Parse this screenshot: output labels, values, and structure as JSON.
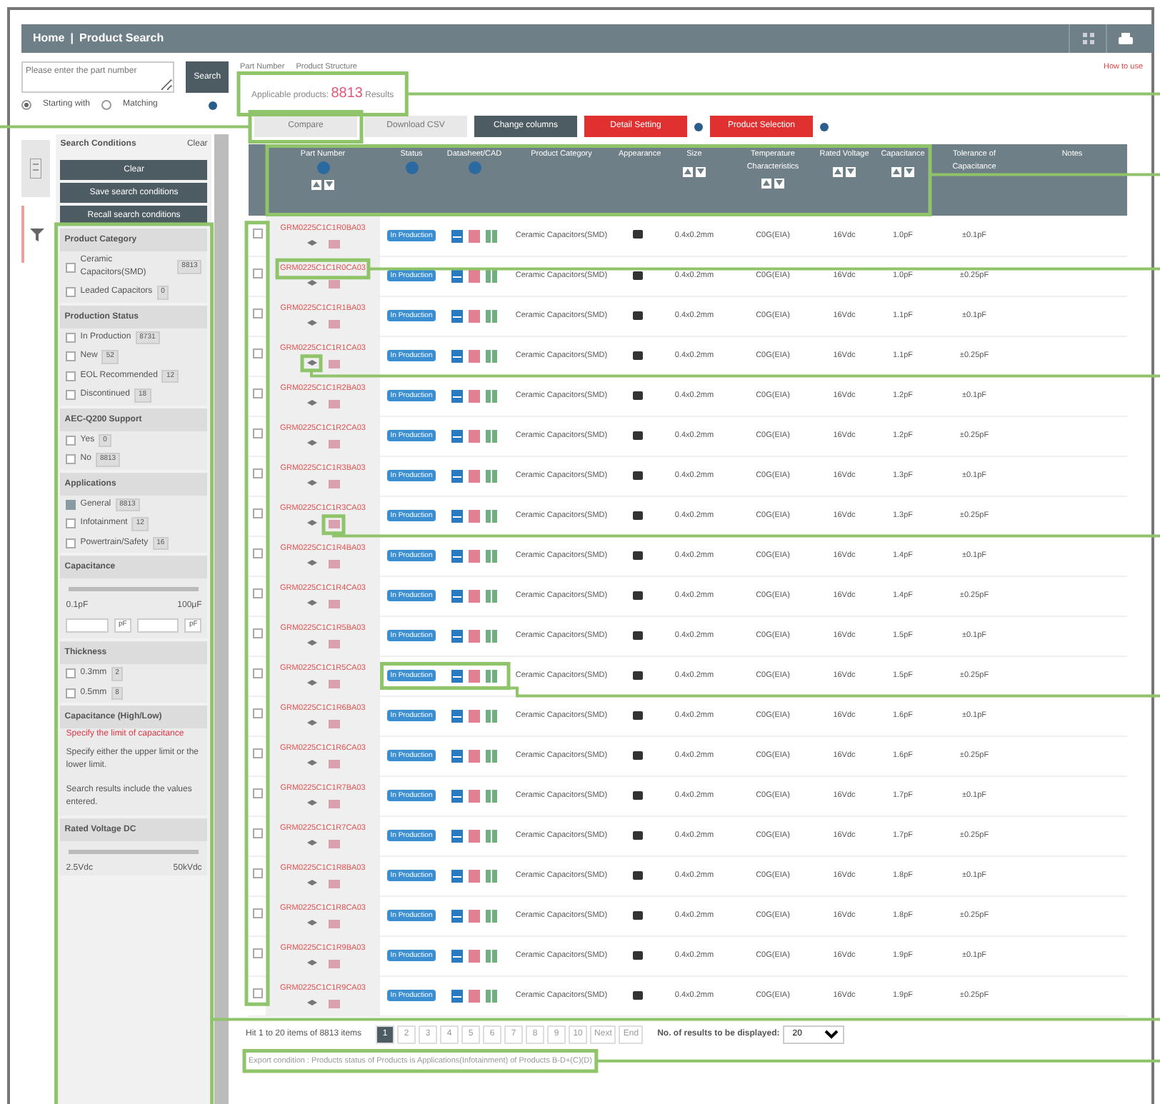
{
  "header": {
    "breadcrumb": [
      "Home",
      "Product Search"
    ],
    "separator": "|"
  },
  "search": {
    "placeholder": "Please enter the part number",
    "button": "Search",
    "modes": [
      {
        "label": "Starting with",
        "selected": true
      },
      {
        "label": "Matching",
        "selected": false
      }
    ]
  },
  "tabs": [
    "Part Number",
    "Product Structure"
  ],
  "help_link": "How to use",
  "result": {
    "label": "Applicable products:",
    "count": "8813",
    "unit": "Results"
  },
  "actions": [
    {
      "label": "Compare",
      "kind": "light"
    },
    {
      "label": "Download CSV",
      "kind": "light"
    },
    {
      "label": "Change columns",
      "kind": "dark"
    },
    {
      "label": "Detail Setting",
      "kind": "red"
    },
    {
      "label": "Product Selection",
      "kind": "red"
    }
  ],
  "sidebar": {
    "title": "Search Conditions",
    "clear": "Clear",
    "buttons": [
      "Clear",
      "Save search conditions",
      "Recall search conditions"
    ],
    "sections": [
      {
        "title": "Product Category",
        "options": [
          {
            "label": "Ceramic Capacitors(SMD)",
            "count": "8813",
            "checked": false
          },
          {
            "label": "Leaded Capacitors",
            "count": "0",
            "checked": false
          }
        ]
      },
      {
        "title": "Production Status",
        "options": [
          {
            "label": "In Production",
            "count": "8731",
            "checked": false
          },
          {
            "label": "New",
            "count": "52",
            "checked": false
          },
          {
            "label": "EOL Recommended",
            "count": "12",
            "checked": false
          },
          {
            "label": "Discontinued",
            "count": "18",
            "checked": false
          }
        ]
      },
      {
        "title": "AEC-Q200 Support",
        "options": [
          {
            "label": "Yes",
            "count": "0",
            "checked": false
          },
          {
            "label": "No",
            "count": "8813",
            "checked": false
          }
        ]
      },
      {
        "title": "Applications",
        "options": [
          {
            "label": "General",
            "count": "8813",
            "checked": true
          },
          {
            "label": "Infotainment",
            "count": "12",
            "checked": false
          },
          {
            "label": "Powertrain/Safety",
            "count": "16",
            "checked": false
          }
        ]
      },
      {
        "title": "Capacitance",
        "range": [
          "0.1pF",
          "100μF"
        ],
        "units": [
          "pF",
          "pF"
        ]
      },
      {
        "title": "Thickness",
        "options": [
          {
            "label": "0.3mm",
            "count": "2",
            "checked": false
          },
          {
            "label": "0.5mm",
            "count": "8",
            "checked": false
          }
        ]
      },
      {
        "title": "Capacitance (High/Low)",
        "link": "Specify the limit of capacitance",
        "notes": [
          "Specify either the upper limit or the lower limit.",
          "Search results include the values entered."
        ]
      },
      {
        "title": "Rated Voltage DC",
        "range": [
          "2.5Vdc",
          "50kVdc"
        ]
      }
    ]
  },
  "table": {
    "columns": [
      "Part Number",
      "Status",
      "Datasheet/CAD",
      "Product Category",
      "Appearance",
      "Size",
      "Temperature Characteristics",
      "Rated Voltage",
      "Capacitance",
      "Tolerance of Capacitance",
      "Notes"
    ],
    "rows": [
      {
        "part": "GRM0225C1C1R0BA03",
        "checked": false,
        "status": "In Production",
        "category": "Ceramic Capacitors(SMD)",
        "size": "0.4x0.2mm",
        "temp": "C0G(EIA)",
        "volt": "16Vdc",
        "cap": "1.0pF",
        "tol": "±0.1pF"
      },
      {
        "part": "GRM0225C1C1R0CA03",
        "checked": false,
        "status": "In Production",
        "category": "Ceramic Capacitors(SMD)",
        "size": "0.4x0.2mm",
        "temp": "C0G(EIA)",
        "volt": "16Vdc",
        "cap": "1.0pF",
        "tol": "±0.25pF"
      },
      {
        "part": "GRM0225C1C1R1BA03",
        "checked": false,
        "status": "In Production",
        "category": "Ceramic Capacitors(SMD)",
        "size": "0.4x0.2mm",
        "temp": "C0G(EIA)",
        "volt": "16Vdc",
        "cap": "1.1pF",
        "tol": "±0.1pF"
      },
      {
        "part": "GRM0225C1C1R1CA03",
        "checked": false,
        "status": "In Production",
        "category": "Ceramic Capacitors(SMD)",
        "size": "0.4x0.2mm",
        "temp": "C0G(EIA)",
        "volt": "16Vdc",
        "cap": "1.1pF",
        "tol": "±0.25pF"
      },
      {
        "part": "GRM0225C1C1R2BA03",
        "checked": false,
        "status": "In Production",
        "category": "Ceramic Capacitors(SMD)",
        "size": "0.4x0.2mm",
        "temp": "C0G(EIA)",
        "volt": "16Vdc",
        "cap": "1.2pF",
        "tol": "±0.1pF"
      },
      {
        "part": "GRM0225C1C1R2CA03",
        "checked": false,
        "status": "In Production",
        "category": "Ceramic Capacitors(SMD)",
        "size": "0.4x0.2mm",
        "temp": "C0G(EIA)",
        "volt": "16Vdc",
        "cap": "1.2pF",
        "tol": "±0.25pF"
      },
      {
        "part": "GRM0225C1C1R3BA03",
        "checked": false,
        "status": "In Production",
        "category": "Ceramic Capacitors(SMD)",
        "size": "0.4x0.2mm",
        "temp": "C0G(EIA)",
        "volt": "16Vdc",
        "cap": "1.3pF",
        "tol": "±0.1pF"
      },
      {
        "part": "GRM0225C1C1R3CA03",
        "checked": false,
        "status": "In Production",
        "category": "Ceramic Capacitors(SMD)",
        "size": "0.4x0.2mm",
        "temp": "C0G(EIA)",
        "volt": "16Vdc",
        "cap": "1.3pF",
        "tol": "±0.25pF"
      },
      {
        "part": "GRM0225C1C1R4BA03",
        "checked": false,
        "status": "In Production",
        "category": "Ceramic Capacitors(SMD)",
        "size": "0.4x0.2mm",
        "temp": "C0G(EIA)",
        "volt": "16Vdc",
        "cap": "1.4pF",
        "tol": "±0.1pF"
      },
      {
        "part": "GRM0225C1C1R4CA03",
        "checked": false,
        "status": "In Production",
        "category": "Ceramic Capacitors(SMD)",
        "size": "0.4x0.2mm",
        "temp": "C0G(EIA)",
        "volt": "16Vdc",
        "cap": "1.4pF",
        "tol": "±0.25pF"
      },
      {
        "part": "GRM0225C1C1R5BA03",
        "checked": false,
        "status": "In Production",
        "category": "Ceramic Capacitors(SMD)",
        "size": "0.4x0.2mm",
        "temp": "C0G(EIA)",
        "volt": "16Vdc",
        "cap": "1.5pF",
        "tol": "±0.1pF"
      },
      {
        "part": "GRM0225C1C1R5CA03",
        "checked": false,
        "status": "In Production",
        "category": "Ceramic Capacitors(SMD)",
        "size": "0.4x0.2mm",
        "temp": "C0G(EIA)",
        "volt": "16Vdc",
        "cap": "1.5pF",
        "tol": "±0.25pF"
      },
      {
        "part": "GRM0225C1C1R6BA03",
        "checked": false,
        "status": "In Production",
        "category": "Ceramic Capacitors(SMD)",
        "size": "0.4x0.2mm",
        "temp": "C0G(EIA)",
        "volt": "16Vdc",
        "cap": "1.6pF",
        "tol": "±0.1pF"
      },
      {
        "part": "GRM0225C1C1R6CA03",
        "checked": false,
        "status": "In Production",
        "category": "Ceramic Capacitors(SMD)",
        "size": "0.4x0.2mm",
        "temp": "C0G(EIA)",
        "volt": "16Vdc",
        "cap": "1.6pF",
        "tol": "±0.25pF"
      },
      {
        "part": "GRM0225C1C1R7BA03",
        "checked": false,
        "status": "In Production",
        "category": "Ceramic Capacitors(SMD)",
        "size": "0.4x0.2mm",
        "temp": "C0G(EIA)",
        "volt": "16Vdc",
        "cap": "1.7pF",
        "tol": "±0.1pF"
      },
      {
        "part": "GRM0225C1C1R7CA03",
        "checked": false,
        "status": "In Production",
        "category": "Ceramic Capacitors(SMD)",
        "size": "0.4x0.2mm",
        "temp": "C0G(EIA)",
        "volt": "16Vdc",
        "cap": "1.7pF",
        "tol": "±0.25pF"
      },
      {
        "part": "GRM0225C1C1R8BA03",
        "checked": false,
        "status": "In Production",
        "category": "Ceramic Capacitors(SMD)",
        "size": "0.4x0.2mm",
        "temp": "C0G(EIA)",
        "volt": "16Vdc",
        "cap": "1.8pF",
        "tol": "±0.1pF"
      },
      {
        "part": "GRM0225C1C1R8CA03",
        "checked": false,
        "status": "In Production",
        "category": "Ceramic Capacitors(SMD)",
        "size": "0.4x0.2mm",
        "temp": "C0G(EIA)",
        "volt": "16Vdc",
        "cap": "1.8pF",
        "tol": "±0.25pF"
      },
      {
        "part": "GRM0225C1C1R9BA03",
        "checked": false,
        "status": "In Production",
        "category": "Ceramic Capacitors(SMD)",
        "size": "0.4x0.2mm",
        "temp": "C0G(EIA)",
        "volt": "16Vdc",
        "cap": "1.9pF",
        "tol": "±0.1pF"
      },
      {
        "part": "GRM0225C1C1R9CA03",
        "checked": false,
        "status": "In Production",
        "category": "Ceramic Capacitors(SMD)",
        "size": "0.4x0.2mm",
        "temp": "C0G(EIA)",
        "volt": "16Vdc",
        "cap": "1.9pF",
        "tol": "±0.25pF"
      }
    ]
  },
  "pagination": {
    "summary": "Hit 1 to 20 items of 8813 items",
    "pages": [
      {
        "label": "1",
        "selected": true
      },
      {
        "label": "2",
        "selected": false
      },
      {
        "label": "3",
        "selected": false
      },
      {
        "label": "4",
        "selected": false
      },
      {
        "label": "5",
        "selected": false
      },
      {
        "label": "6",
        "selected": false
      },
      {
        "label": "7",
        "selected": false
      },
      {
        "label": "8",
        "selected": false
      },
      {
        "label": "9",
        "selected": false
      },
      {
        "label": "10",
        "selected": false
      },
      {
        "label": "Next",
        "selected": false
      },
      {
        "label": "End",
        "selected": false
      }
    ],
    "per_page_label": "No. of results to be displayed:",
    "per_page": "20"
  },
  "footnote": "Export condition : Products status of Products is Applications(Infotainment) of Products B-D+(C)(D)"
}
